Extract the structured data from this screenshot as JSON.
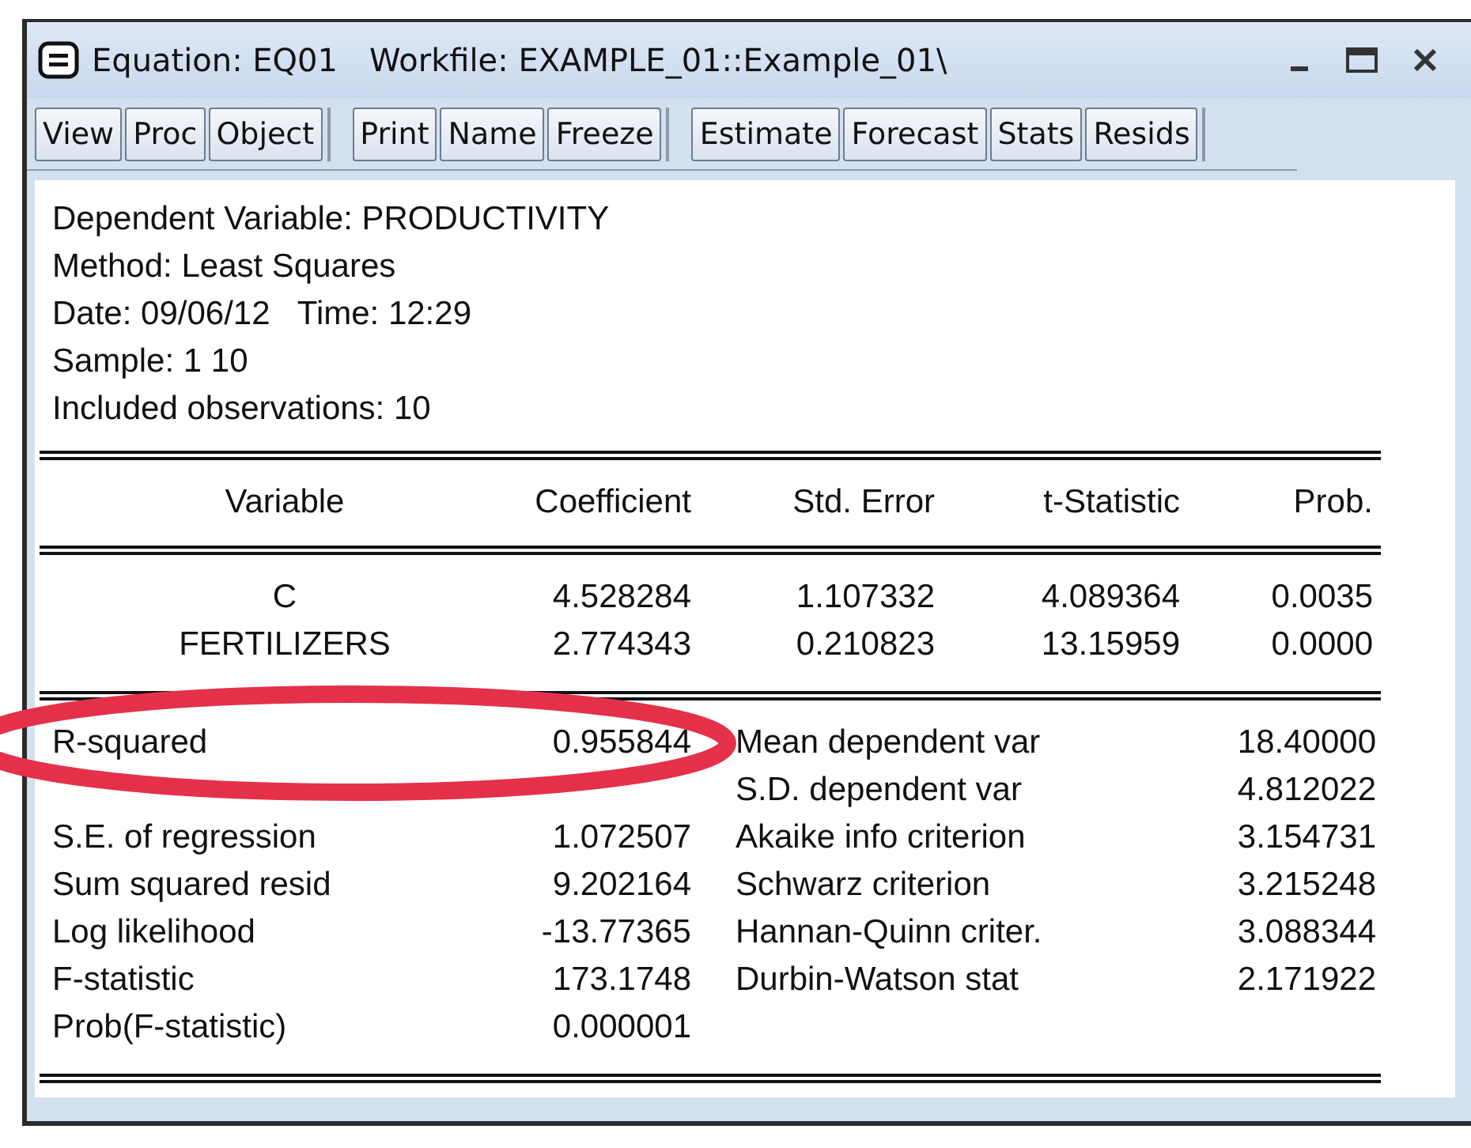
{
  "window": {
    "title": "Equation: EQ01",
    "workfile": "Workfile: EXAMPLE_01::Example_01\\"
  },
  "toolbar_groups": [
    [
      "View",
      "Proc",
      "Object"
    ],
    [
      "Print",
      "Name",
      "Freeze"
    ],
    [
      "Estimate",
      "Forecast",
      "Stats",
      "Resids"
    ]
  ],
  "header_lines": [
    "Dependent Variable: PRODUCTIVITY",
    "Method: Least Squares",
    "Date: 09/06/12   Time: 12:29",
    "Sample: 1 10",
    "Included observations: 10"
  ],
  "table": {
    "columns": [
      "Variable",
      "Coefficient",
      "Std. Error",
      "t-Statistic",
      "Prob."
    ],
    "rows": [
      [
        "C",
        "4.528284",
        "1.107332",
        "4.089364",
        "0.0035"
      ],
      [
        "FERTILIZERS",
        "2.774343",
        "0.210823",
        "13.15959",
        "0.0000"
      ]
    ]
  },
  "statistics": [
    {
      "label": "R-squared",
      "value": "0.955844",
      "label_2": "Mean dependent var",
      "value_2": "18.40000"
    },
    {
      "label_2": "S.D. dependent var",
      "value_2": "4.812022"
    },
    {
      "label": "S.E. of regression",
      "value": "1.072507",
      "label_2": "Akaike info criterion",
      "value_2": "3.154731"
    },
    {
      "label": "Sum squared resid",
      "value": "9.202164",
      "label_2": "Schwarz criterion",
      "value_2": "3.215248"
    },
    {
      "label": "Log likelihood",
      "value": "-13.77365",
      "label_2": "Hannan-Quinn criter.",
      "value_2": "3.088344"
    },
    {
      "label": "F-statistic",
      "value": "173.1748",
      "label_2": "Durbin-Watson stat",
      "value_2": "2.171922"
    },
    {
      "label": "Prob(F-statistic)",
      "value": "0.000001"
    }
  ]
}
